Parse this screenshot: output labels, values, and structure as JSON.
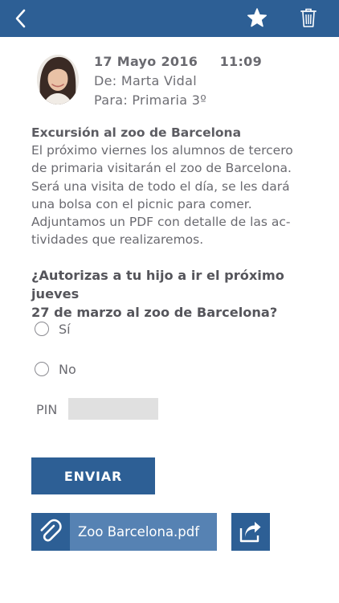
{
  "header": {
    "back_icon": "chevron-left-icon",
    "favorite_icon": "star-icon",
    "delete_icon": "trash-icon"
  },
  "message": {
    "date": "17 Mayo 2016",
    "time": "11:09",
    "from": "De: Marta Vidal",
    "to": "Para: Primaria 3º",
    "subject": "Excursión al zoo de Barcelona",
    "body_lines": [
      "El próximo viernes los alumnos de tercero",
      "de primaria visitarán el zoo de Barcelona.",
      "Será una visita de todo el día, se les dará",
      "una bolsa con el picnic para comer.",
      "Adjuntamos un PDF con detalle de las ac-",
      "tividades que realizaremos."
    ]
  },
  "form": {
    "question_lines": [
      "¿Autorizas a tu hijo a ir el próximo jueves",
      "27 de marzo al zoo de Barcelona?"
    ],
    "options": [
      "Sí",
      "No"
    ],
    "pin_label": "PIN",
    "pin_value": "",
    "submit_label": "ENVIAR"
  },
  "attachment": {
    "file_name": "Zoo Barcelona.pdf",
    "icon": "paperclip-icon",
    "share_icon": "share-icon"
  },
  "colors": {
    "primary": "#2d5f95",
    "attachment_bg": "#5682b3",
    "text": "#6a6a70"
  }
}
